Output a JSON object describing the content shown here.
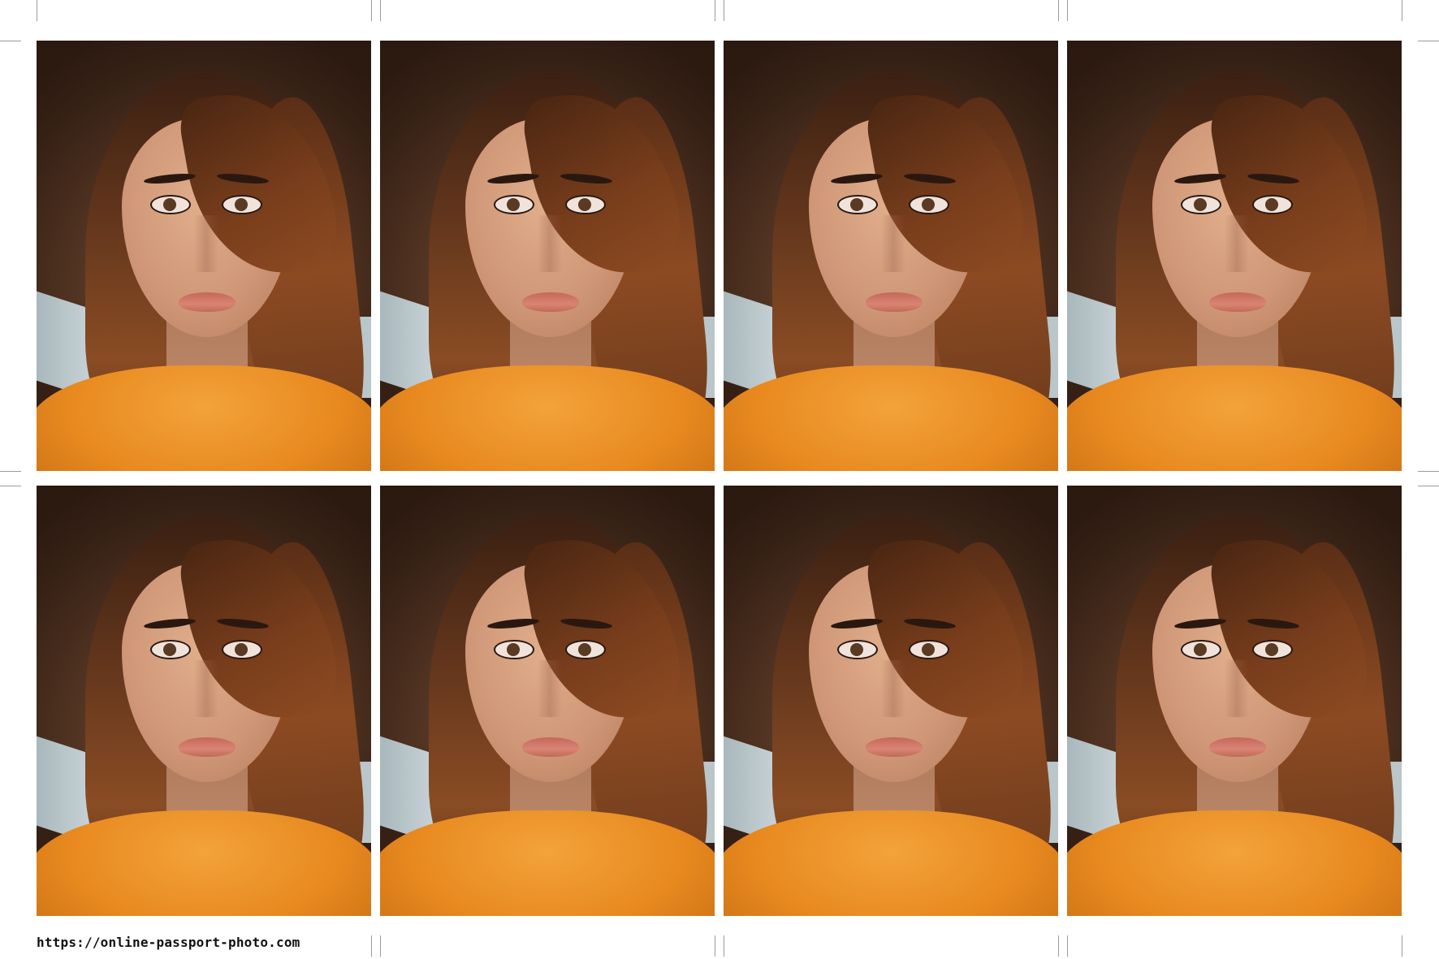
{
  "sheet": {
    "site_url": "https://online-passport-photo.com",
    "photo_count": 8,
    "photo_description_icon": "portrait-photo",
    "colors": {
      "background": "#ffffff",
      "crop_mark": "#9a9a9a",
      "sweater": "#e8891f",
      "hair": "#6a3a1e"
    }
  }
}
